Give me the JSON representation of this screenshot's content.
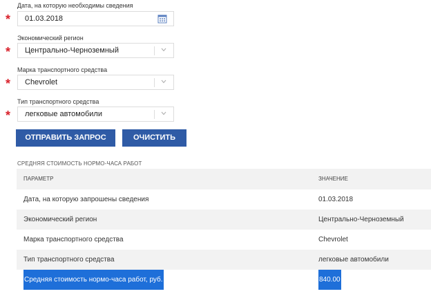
{
  "form": {
    "date": {
      "label": "Дата, на которую необходимы сведения",
      "value": "01.03.2018"
    },
    "region": {
      "label": "Экономический регион",
      "value": "Центрально-Черноземный"
    },
    "brand": {
      "label": "Марка транспортного средства",
      "value": "Chevrolet"
    },
    "vehicle_type": {
      "label": "Тип транспортного средства",
      "value": "легковые автомобили"
    },
    "required_mark": "*"
  },
  "buttons": {
    "submit": "ОТПРАВИТЬ ЗАПРОС",
    "clear": "ОЧИСТИТЬ"
  },
  "result": {
    "title": "СРЕДНЯЯ СТОИМОСТЬ НОРМО-ЧАСА РАБОТ",
    "headers": {
      "param": "ПАРАМЕТР",
      "value": "ЗНАЧЕНИЕ"
    },
    "rows": [
      {
        "param": "Дата, на которую запрошены сведения",
        "value": "01.03.2018"
      },
      {
        "param": "Экономический регион",
        "value": "Центрально-Черноземный"
      },
      {
        "param": "Марка транспортного средства",
        "value": "Chevrolet"
      },
      {
        "param": "Тип транспортного средства",
        "value": "легковые автомобили"
      },
      {
        "param": "Средняя стоимость нормо-часа работ, руб.",
        "value": "840.00"
      }
    ]
  },
  "colors": {
    "accent": "#2f5ba6",
    "required": "#d9232d",
    "selection": "#1e6fd9"
  },
  "icons": {
    "date": "calendar-icon",
    "select": "chevron-down-icon"
  }
}
